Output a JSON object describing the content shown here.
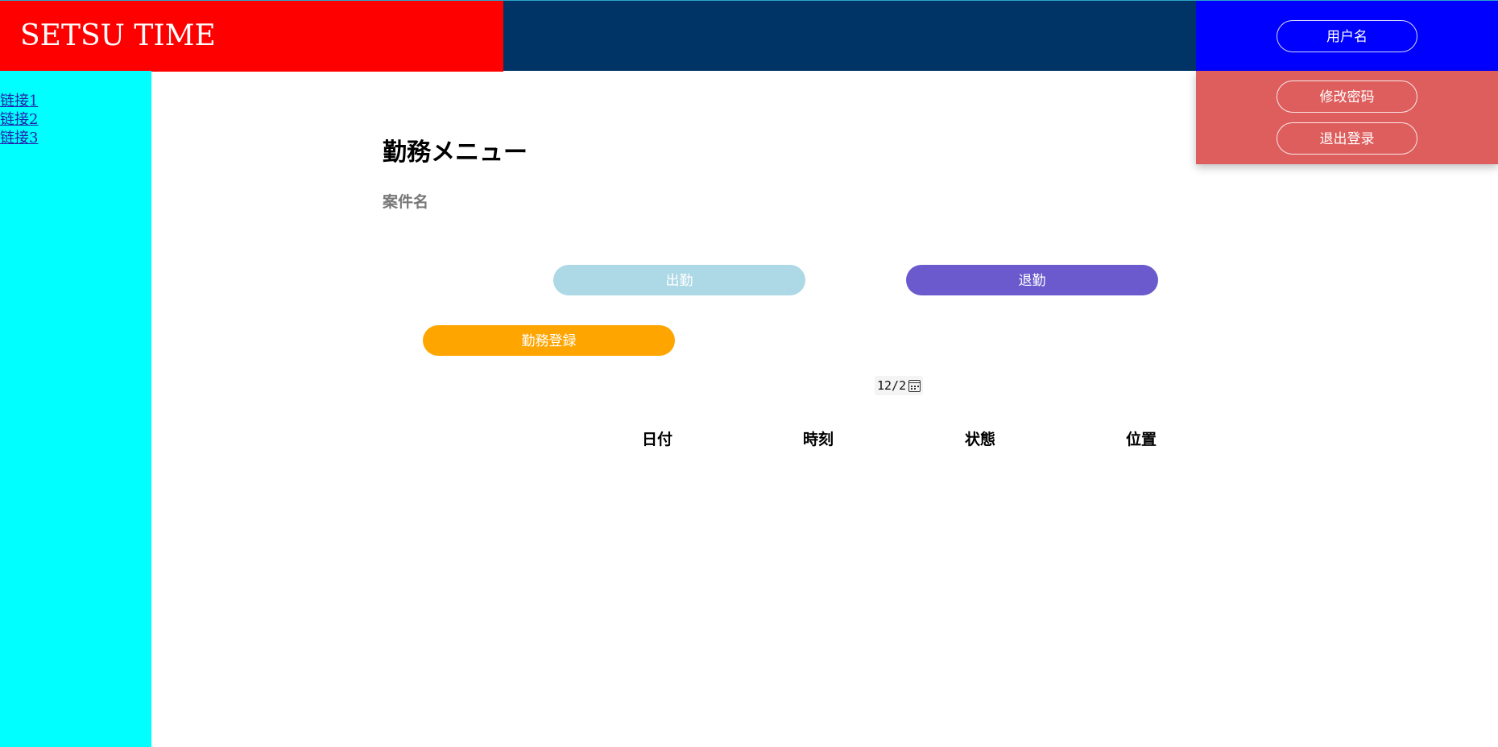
{
  "header": {
    "brand": "SETSU TIME",
    "user_button": "用户名"
  },
  "user_menu": {
    "change_password": "修改密码",
    "logout": "退出登录"
  },
  "sidebar": {
    "links": [
      {
        "label": "链接1"
      },
      {
        "label": "链接2"
      },
      {
        "label": "链接3"
      }
    ]
  },
  "main": {
    "title": "勤務メニュー",
    "project_name": "案件名",
    "buttons": {
      "clock_in": "出勤",
      "clock_out": "退勤",
      "register": "勤務登録"
    },
    "date_picker": {
      "value": "12/2",
      "icon": "calendar-icon"
    },
    "table": {
      "columns": [
        "日付",
        "時刻",
        "状態",
        "位置"
      ],
      "rows": []
    }
  },
  "colors": {
    "brand_bg": "#ff0000",
    "header_bg": "#003366",
    "user_area_bg": "#0000ff",
    "dropdown_bg": "#de5e5e",
    "sidebar_bg": "#00ffff",
    "clock_in_bg": "#add8e6",
    "clock_out_bg": "#6a5acd",
    "register_bg": "#ffa500"
  }
}
